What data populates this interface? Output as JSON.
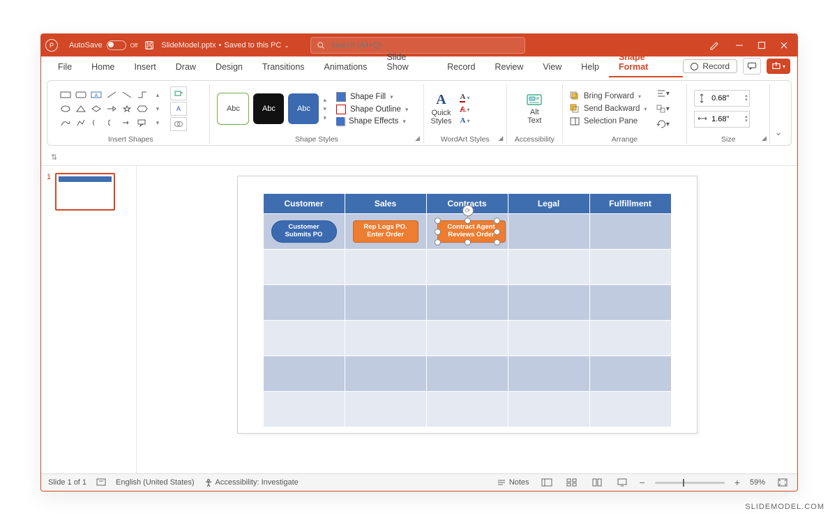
{
  "titlebar": {
    "autosave_label": "AutoSave",
    "autosave_state": "Off",
    "filename": "SlideModel.pptx",
    "save_state": "Saved to this PC",
    "search_placeholder": "Search (Alt+Q)"
  },
  "tabs": [
    "File",
    "Home",
    "Insert",
    "Draw",
    "Design",
    "Transitions",
    "Animations",
    "Slide Show",
    "Record",
    "Review",
    "View",
    "Help",
    "Shape Format"
  ],
  "active_tab": "Shape Format",
  "record_chip": "Record",
  "ribbon": {
    "groups": {
      "insert_shapes": "Insert Shapes",
      "shape_styles": "Shape Styles",
      "wordart_styles": "WordArt Styles",
      "accessibility": "Accessibility",
      "arrange": "Arrange",
      "size": "Size"
    },
    "abc": "Abc",
    "shape_fill": "Shape Fill",
    "shape_outline": "Shape Outline",
    "shape_effects": "Shape Effects",
    "quick_styles": "Quick\nStyles",
    "alt_text": "Alt\nText",
    "bring_forward": "Bring Forward",
    "send_backward": "Send Backward",
    "selection_pane": "Selection Pane",
    "size_h": "0.68\"",
    "size_w": "1.68\""
  },
  "thumb_number": "1",
  "swimlane": {
    "headers": [
      "Customer",
      "Sales",
      "Contracts",
      "Legal",
      "Fulfillment"
    ],
    "shapes": {
      "customer": "Customer\nSubmits PO",
      "sales": "Rep Logs PO.\nEnter Order",
      "contracts": "Contract Agent\nReviews Order"
    }
  },
  "statusbar": {
    "slide": "Slide 1 of 1",
    "language": "English (United States)",
    "accessibility": "Accessibility: Investigate",
    "notes": "Notes",
    "zoom": "59%"
  },
  "watermark": "SLIDEMODEL.COM"
}
